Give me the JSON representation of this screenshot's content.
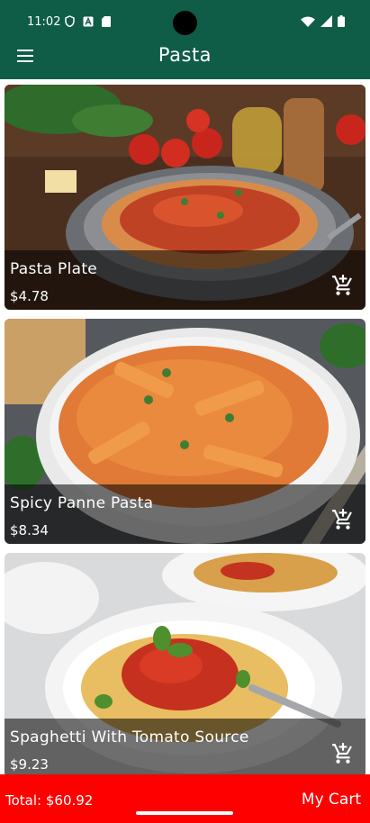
{
  "status_bar": {
    "time": "11:02"
  },
  "app_bar": {
    "title": "Pasta"
  },
  "products": [
    {
      "name": "Pasta Plate",
      "price": "$4.78"
    },
    {
      "name": "Spicy Panne Pasta",
      "price": "$8.34"
    },
    {
      "name": "Spaghetti With Tomato Source",
      "price": "$9.23"
    }
  ],
  "footer": {
    "total": "Total: $60.92",
    "cart_label": "My Cart"
  },
  "colors": {
    "primary": "#0f5c47",
    "footer": "#ff0000"
  },
  "icons": {
    "menu": "hamburger-icon",
    "add_to_cart": "add-shopping-cart-icon"
  }
}
